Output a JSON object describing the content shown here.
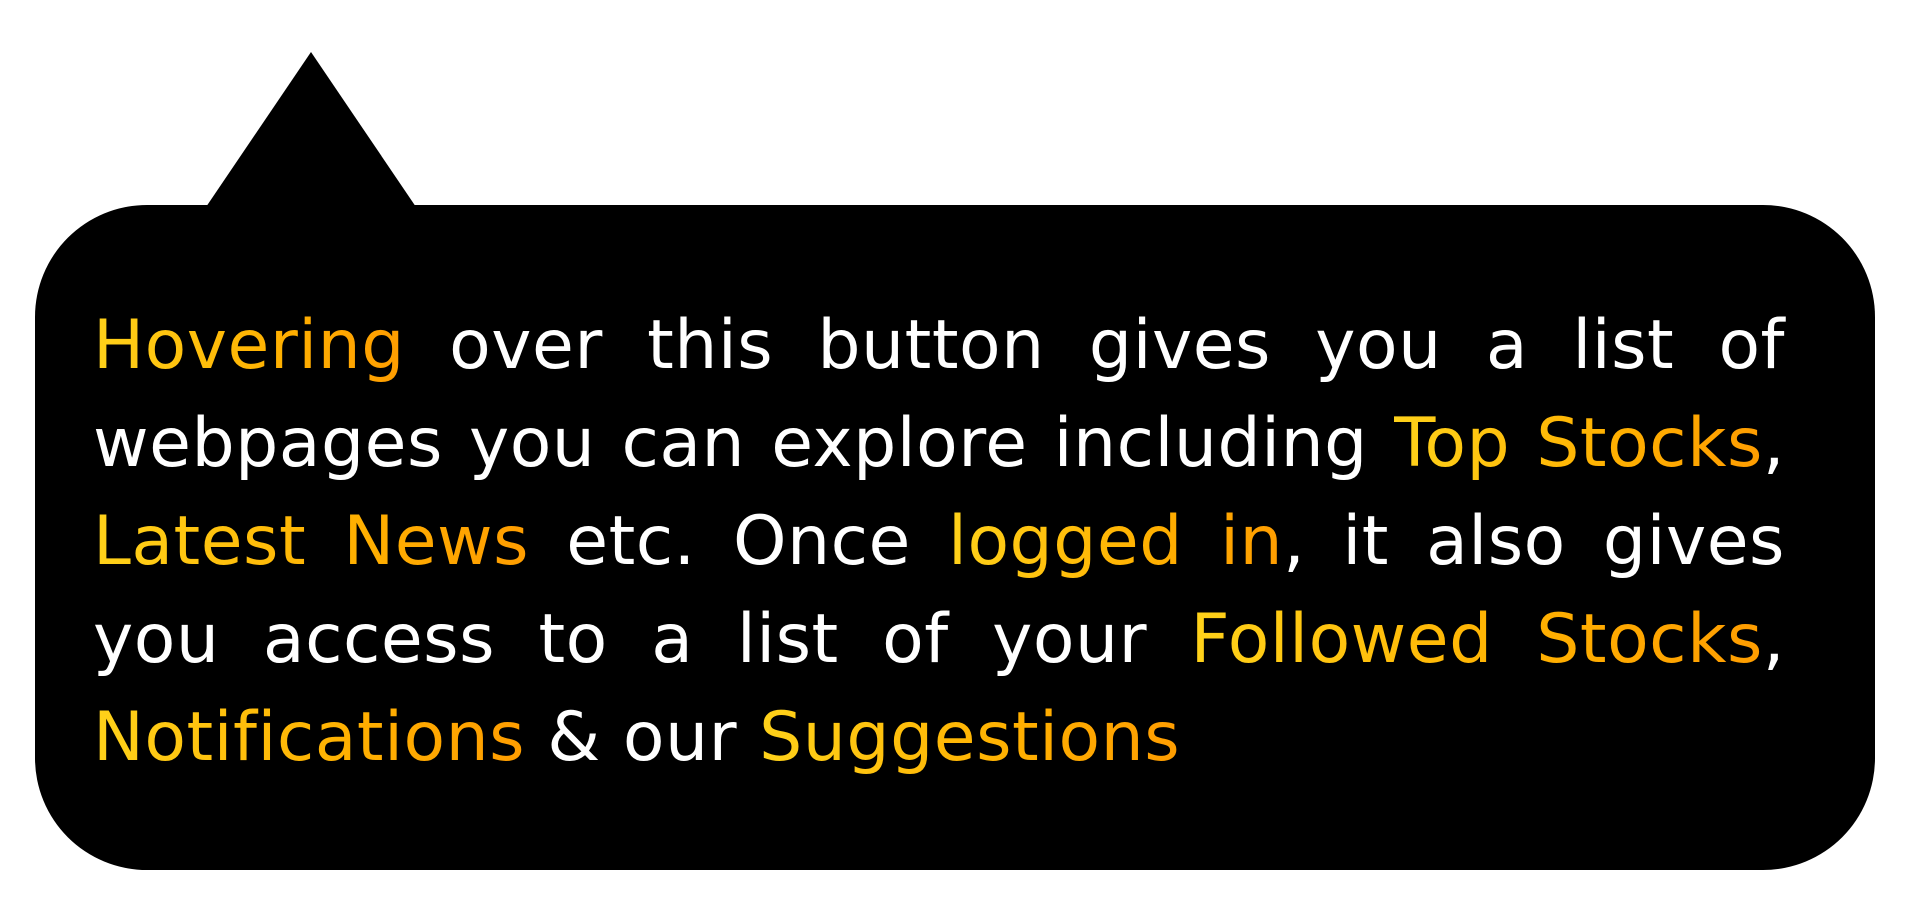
{
  "tooltip": {
    "segments": [
      {
        "text": "Hovering",
        "highlight": true
      },
      {
        "text": " over this button gives you a list of webpages you can explore including ",
        "highlight": false
      },
      {
        "text": "Top Stocks",
        "highlight": true
      },
      {
        "text": ", ",
        "highlight": false
      },
      {
        "text": "Latest News",
        "highlight": true
      },
      {
        "text": " etc. Once ",
        "highlight": false
      },
      {
        "text": "logged in",
        "highlight": true
      },
      {
        "text": ", it also gives you access to a list of your ",
        "highlight": false
      },
      {
        "text": "Followed Stocks",
        "highlight": true
      },
      {
        "text": ", ",
        "highlight": false
      },
      {
        "text": "Notifications",
        "highlight": true
      },
      {
        "text": " & our ",
        "highlight": false
      },
      {
        "text": "Suggestions",
        "highlight": true
      }
    ]
  },
  "colors": {
    "bubble_background": "#000000",
    "text": "#ffffff",
    "highlight_start": "#ffd21a",
    "highlight_end": "#ff9d00"
  }
}
